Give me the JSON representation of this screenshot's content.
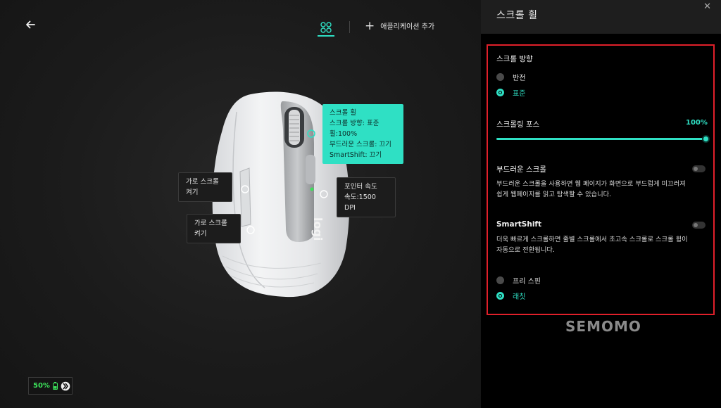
{
  "panel": {
    "title": "스크롤 휠",
    "close_glyph": "✕"
  },
  "toolbar": {
    "add_app_label": "애플리케이션 추가",
    "back_icon": "arrow-left-icon",
    "grid_icon": "four-circles-icon"
  },
  "callouts": {
    "scroll": {
      "line1": "스크롤 휠",
      "line2": "스크롤 방향: 표준",
      "line3": "휠:100%",
      "line4": "부드러운 스크롤: 끄기",
      "line5": "SmartShift: 끄기"
    },
    "pointer": {
      "line1": "포인터 속도",
      "line2": "속도:1500 DPI"
    },
    "hscroll1": {
      "line1": "가로 스크롤",
      "line2": "켜기"
    },
    "hscroll2": {
      "line1": "가로 스크롤",
      "line2": "켜기"
    },
    "logo_text": "logi"
  },
  "battery": {
    "percent": "50%"
  },
  "settings": {
    "direction": {
      "label": "스크롤 방향",
      "options": [
        "반전",
        "표준"
      ],
      "selected": "표준"
    },
    "force": {
      "label": "스크롤링 포스",
      "value": "100%",
      "level": 1.0
    },
    "smooth": {
      "label": "부드러운 스크롤",
      "desc1": "부드러운 스크롤을 사용하면 웹 페이지가 화면으로 부드럽게 미끄러져",
      "desc2": "쉽게 웹페이지를 읽고 탐색할 수 있습니다.",
      "enabled": false
    },
    "smartshift": {
      "label": "SmartShift",
      "desc1": "더욱 빠르게 스크롤하면 줄별 스크롤에서 초고속 스크롤로 스크롤 휠이",
      "desc2": "자동으로 전환됩니다.",
      "enabled": false
    },
    "mode": {
      "options": [
        "프리 스핀",
        "래칫"
      ],
      "selected": "래칫"
    }
  },
  "watermark": "SEMOMO",
  "colors": {
    "accent": "#2fe0c4",
    "highlight_border": "#e0202a",
    "battery": "#3ce05a"
  }
}
